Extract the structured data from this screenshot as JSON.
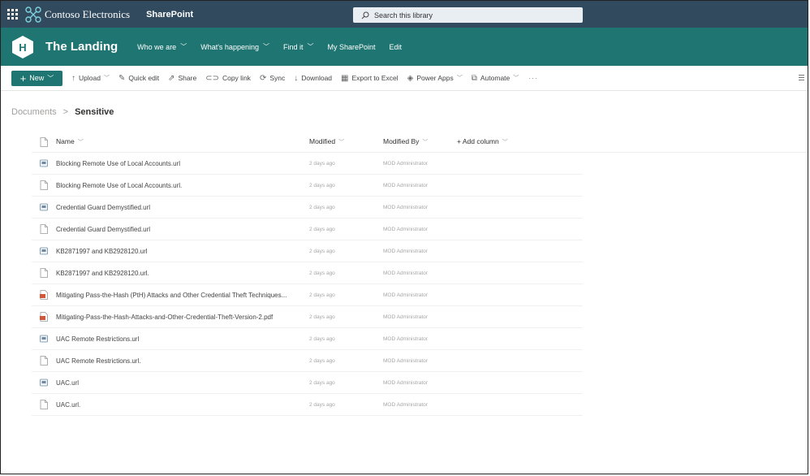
{
  "suite_bar": {
    "brand": "Contoso Electronics",
    "app": "SharePoint",
    "search_placeholder": "Search this library"
  },
  "site": {
    "logo_letter": "H",
    "title": "The Landing",
    "nav": [
      {
        "label": "Who we are",
        "has_menu": true
      },
      {
        "label": "What's happening",
        "has_menu": true
      },
      {
        "label": "Find it",
        "has_menu": true
      },
      {
        "label": "My SharePoint",
        "has_menu": false
      },
      {
        "label": "Edit",
        "has_menu": false
      }
    ]
  },
  "command_bar": {
    "new": "New",
    "commands": [
      {
        "label": "Upload",
        "icon": "upload-icon",
        "glyph": "↑",
        "menu": true
      },
      {
        "label": "Quick edit",
        "icon": "pencil-icon",
        "glyph": "✎",
        "menu": false
      },
      {
        "label": "Share",
        "icon": "share-icon",
        "glyph": "⇗",
        "menu": false
      },
      {
        "label": "Copy link",
        "icon": "link-icon",
        "glyph": "⊂⊃",
        "menu": false
      },
      {
        "label": "Sync",
        "icon": "sync-icon",
        "glyph": "⟳",
        "menu": false
      },
      {
        "label": "Download",
        "icon": "download-icon",
        "glyph": "↓",
        "menu": false
      },
      {
        "label": "Export to Excel",
        "icon": "excel-icon",
        "glyph": "▦",
        "menu": false
      },
      {
        "label": "Power Apps",
        "icon": "powerapps-icon",
        "glyph": "◈",
        "menu": true
      },
      {
        "label": "Automate",
        "icon": "automate-icon",
        "glyph": "⧉",
        "menu": true
      }
    ],
    "more": "···"
  },
  "breadcrumb": {
    "root": "Documents",
    "separator": ">",
    "current": "Sensitive"
  },
  "table": {
    "headers": {
      "name": "Name",
      "modified": "Modified",
      "modified_by": "Modified By",
      "add_column": "+ Add column"
    },
    "rows": [
      {
        "type": "url",
        "name": "Blocking Remote Use of Local Accounts.url",
        "modified": "2 days ago",
        "modified_by": "MOD Administrator"
      },
      {
        "type": "doc",
        "name": "Blocking Remote Use of Local Accounts.url.",
        "modified": "2 days ago",
        "modified_by": "MOD Administrator"
      },
      {
        "type": "url",
        "name": "Credential Guard Demystified.url",
        "modified": "2 days ago",
        "modified_by": "MOD Administrator"
      },
      {
        "type": "doc",
        "name": "Credential Guard Demystified.url",
        "modified": "2 days ago",
        "modified_by": "MOD Administrator"
      },
      {
        "type": "url",
        "name": "KB2871997 and KB2928120.url",
        "modified": "2 days ago",
        "modified_by": "MOD Administrator"
      },
      {
        "type": "doc",
        "name": "KB2871997 and KB2928120.url.",
        "modified": "2 days ago",
        "modified_by": "MOD Administrator"
      },
      {
        "type": "pdf",
        "name": "Mitigating Pass-the-Hash (PtH) Attacks and Other Credential Theft Techniques...",
        "modified": "2 days ago",
        "modified_by": "MOD Administrator"
      },
      {
        "type": "pdf",
        "name": "Mitigating-Pass-the-Hash-Attacks-and-Other-Credential-Theft-Version-2.pdf",
        "modified": "2 days ago",
        "modified_by": "MOD Administrator"
      },
      {
        "type": "url",
        "name": "UAC Remote Restrictions.url",
        "modified": "2 days ago",
        "modified_by": "MOD Administrator"
      },
      {
        "type": "doc",
        "name": "UAC Remote Restrictions.url.",
        "modified": "2 days ago",
        "modified_by": "MOD Administrator"
      },
      {
        "type": "url",
        "name": "UAC.url",
        "modified": "2 days ago",
        "modified_by": "MOD Administrator"
      },
      {
        "type": "doc",
        "name": "UAC.url.",
        "modified": "2 days ago",
        "modified_by": "MOD Administrator"
      }
    ]
  },
  "colors": {
    "suite_bar": "#314a5e",
    "theme": "#1f7571",
    "pdf": "#d0573a"
  }
}
